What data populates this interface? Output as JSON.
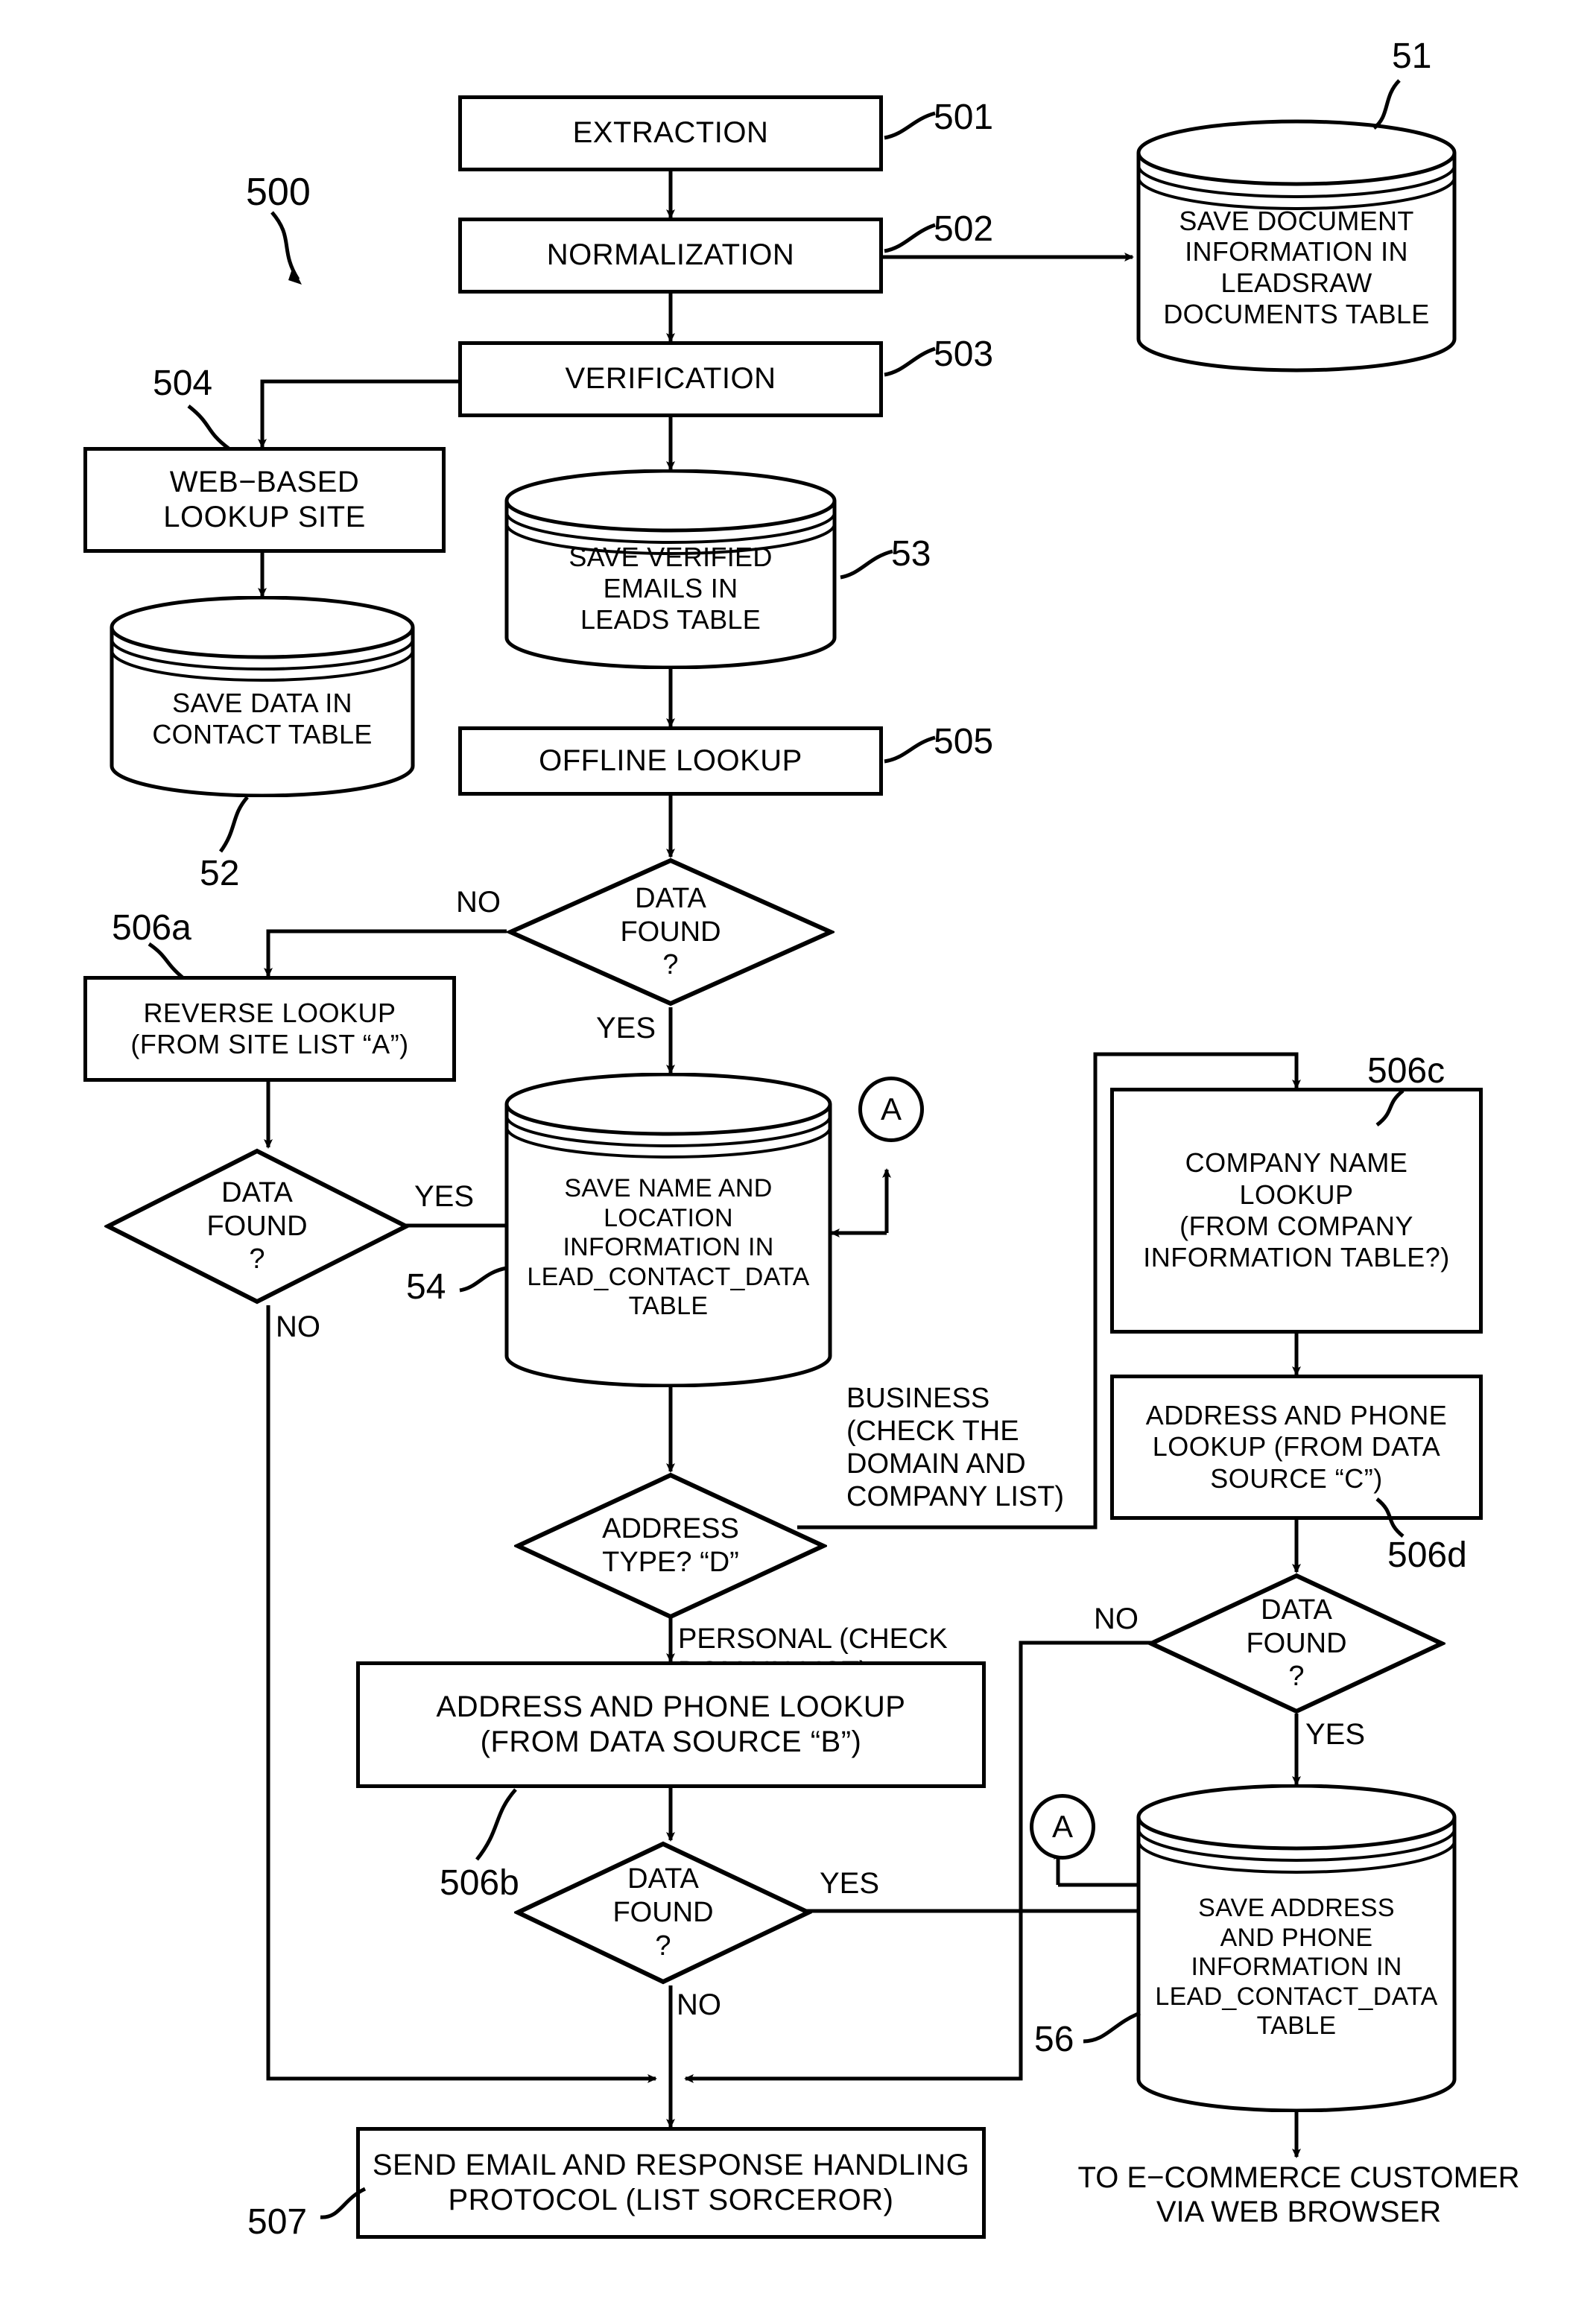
{
  "figure": {
    "figure_number": "500",
    "nodes": [
      {
        "id": "extraction",
        "shape": "process",
        "label": "EXTRACTION",
        "ref": "501"
      },
      {
        "id": "normalization",
        "shape": "process",
        "label": "NORMALIZATION",
        "ref": "502"
      },
      {
        "id": "verification",
        "shape": "process",
        "label": "VERIFICATION",
        "ref": "503"
      },
      {
        "id": "save_document",
        "shape": "cylinder",
        "label": "SAVE DOCUMENT\nINFORMATION IN\nLEADSRAW\nDOCUMENTS TABLE",
        "ref": "51"
      },
      {
        "id": "web_lookup",
        "shape": "process",
        "label": "WEB−BASED\nLOOKUP SITE",
        "ref": "504"
      },
      {
        "id": "save_contact",
        "shape": "cylinder",
        "label": "SAVE DATA IN\nCONTACT TABLE",
        "ref": "52"
      },
      {
        "id": "save_verified",
        "shape": "cylinder",
        "label": "SAVE VERIFIED\nEMAILS IN\nLEADS TABLE",
        "ref": "53"
      },
      {
        "id": "offline_lookup",
        "shape": "process",
        "label": "OFFLINE LOOKUP",
        "ref": "505"
      },
      {
        "id": "data_found_1",
        "shape": "decision",
        "label": "DATA\nFOUND\n?",
        "ref": ""
      },
      {
        "id": "reverse_lookup",
        "shape": "process",
        "label": "REVERSE LOOKUP\n(FROM SITE LIST “A”)",
        "ref": "506a"
      },
      {
        "id": "data_found_2",
        "shape": "decision",
        "label": "DATA\nFOUND\n?",
        "ref": ""
      },
      {
        "id": "save_name_loc",
        "shape": "cylinder",
        "label": "SAVE NAME AND\nLOCATION\nINFORMATION IN\nLEAD_CONTACT_DATA\nTABLE",
        "ref": "54"
      },
      {
        "id": "company_lookup",
        "shape": "process",
        "label": "COMPANY NAME\nLOOKUP\n(FROM COMPANY\nINFORMATION TABLE?)",
        "ref": "506c"
      },
      {
        "id": "addr_phone_c",
        "shape": "process",
        "label": "ADDRESS AND PHONE\nLOOKUP (FROM DATA\nSOURCE “C”)",
        "ref": ""
      },
      {
        "id": "data_found_4",
        "shape": "decision",
        "label": "DATA\nFOUND\n?",
        "ref": "506d"
      },
      {
        "id": "address_type",
        "shape": "decision",
        "label": "ADDRESS\nTYPE? “D”",
        "ref": ""
      },
      {
        "id": "addr_phone_b",
        "shape": "process",
        "label": "ADDRESS AND PHONE LOOKUP\n(FROM DATA SOURCE “B”)",
        "ref": "506b"
      },
      {
        "id": "data_found_3",
        "shape": "decision",
        "label": "DATA\nFOUND\n?",
        "ref": ""
      },
      {
        "id": "save_addr_phone",
        "shape": "cylinder",
        "label": "SAVE ADDRESS\nAND PHONE\nINFORMATION IN\nLEAD_CONTACT_DATA\nTABLE",
        "ref": "56"
      },
      {
        "id": "send_email",
        "shape": "process",
        "label": "SEND EMAIL AND RESPONSE HANDLING\nPROTOCOL (LIST SORCEROR)",
        "ref": "507"
      }
    ],
    "connectors": [
      {
        "id": "conn_a_top",
        "label": "A"
      },
      {
        "id": "conn_a_bottom",
        "label": "A"
      }
    ],
    "edge_labels": {
      "no_1": "NO",
      "yes_1": "YES",
      "yes_2": "YES",
      "no_2": "NO",
      "business": "BUSINESS\n(CHECK THE\nDOMAIN AND\nCOMPANY LIST)",
      "personal": "PERSONAL (CHECK\nDOMAIN LIST)",
      "no_4": "NO",
      "yes_4": "YES",
      "yes_3": "YES",
      "no_3": "NO"
    },
    "terminal_note": "TO E−COMMERCE CUSTOMER\nVIA WEB BROWSER",
    "ref_labels": {
      "r500": "500",
      "r501": "501",
      "r502": "502",
      "r503": "503",
      "r504": "504",
      "r505": "505",
      "r51": "51",
      "r52": "52",
      "r53": "53",
      "r54": "54",
      "r56": "56",
      "r507": "507",
      "r506a": "506a",
      "r506b": "506b",
      "r506c": "506c",
      "r506d": "506d"
    },
    "colors": {
      "ink": "#000000",
      "paper": "#ffffff"
    }
  }
}
